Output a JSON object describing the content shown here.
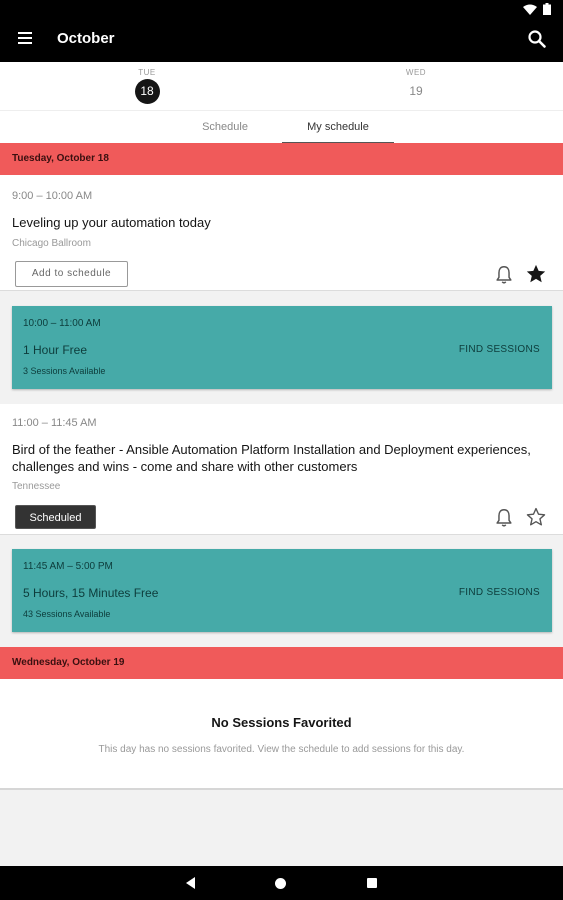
{
  "app_bar": {
    "title": "October"
  },
  "days": [
    {
      "abbr": "TUE",
      "num": "18"
    },
    {
      "abbr": "WED",
      "num": "19"
    }
  ],
  "tabs": [
    {
      "label": "Schedule"
    },
    {
      "label": "My schedule"
    }
  ],
  "date_headers": [
    "Tuesday, October 18",
    "Wednesday, October 19"
  ],
  "sessions": [
    {
      "time": "9:00 – 10:00 AM",
      "title": "Leveling up your automation today",
      "room": "Chicago Ballroom",
      "action_label": "Add to schedule"
    },
    {
      "time": "11:00 – 11:45 AM",
      "title": "Bird of the feather - Ansible Automation Platform Installation and Deployment experiences, challenges and wins - come and share with other customers",
      "room": "Tennessee",
      "status_label": "Scheduled"
    }
  ],
  "free_blocks": [
    {
      "time": "10:00 – 11:00 AM",
      "label": "1 Hour Free",
      "count": "3 Sessions Available",
      "action": "FIND SESSIONS"
    },
    {
      "time": "11:45 AM – 5:00 PM",
      "label": "5 Hours, 15 Minutes Free",
      "count": "43 Sessions Available",
      "action": "FIND SESSIONS"
    }
  ],
  "empty_state": {
    "title": "No Sessions Favorited",
    "description": "This day has no sessions favorited. View the schedule to add sessions for this day."
  },
  "colors": {
    "date_header_bg": "#f05a5a",
    "free_block_bg": "#46aaa8",
    "app_bar_bg": "#000000"
  },
  "icons": {
    "menu": "menu-icon",
    "search": "search-icon",
    "bell": "bell-icon",
    "star_filled": "star-filled-icon",
    "star_outline": "star-outline-icon"
  }
}
